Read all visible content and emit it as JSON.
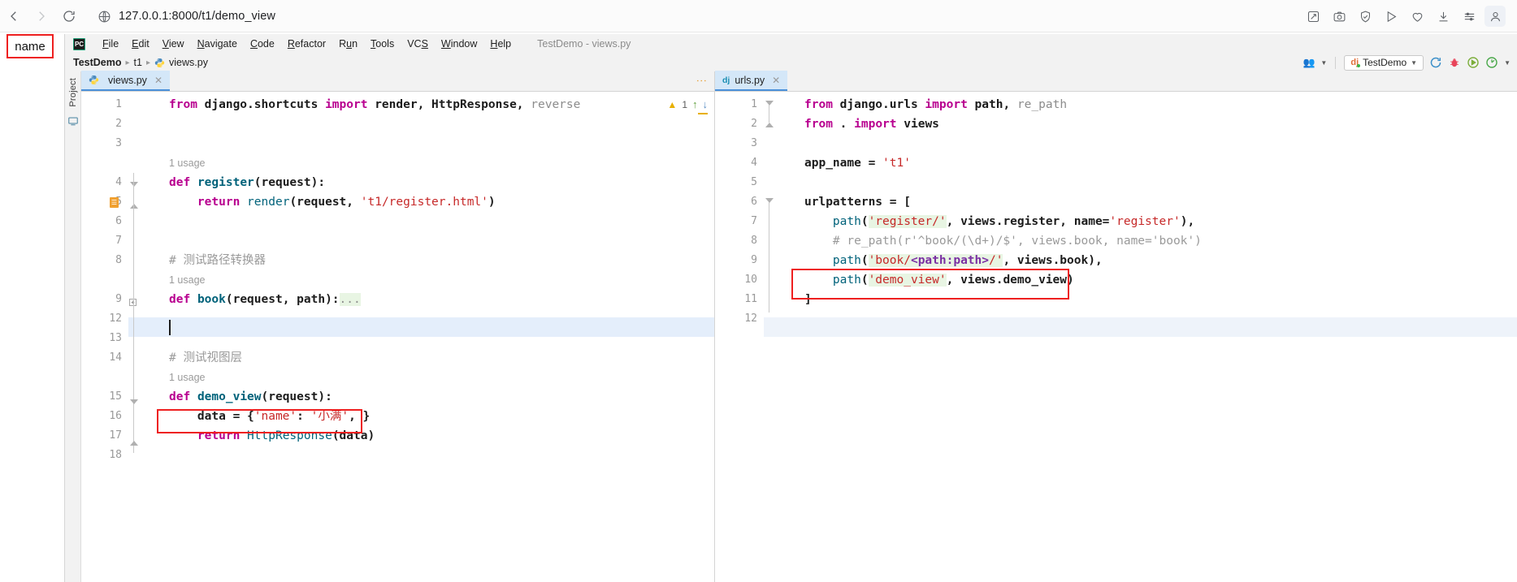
{
  "browser": {
    "back_label": "‹",
    "forward_label": "›",
    "reload_label": "C",
    "url_prefix": "127.0.0.1",
    "url_suffix": ":8000/t1/demo_view",
    "url_full": "127.0.0.1:8000/t1/demo_view",
    "actions": [
      "edit-collect-icon",
      "screenshot-icon",
      "shield-icon",
      "send-icon",
      "heart-icon",
      "download-icon",
      "settings-sliders-icon",
      "profile-icon"
    ]
  },
  "annotations": {
    "name_callout": "name"
  },
  "ide": {
    "logo": "PC",
    "menu": [
      "File",
      "Edit",
      "View",
      "Navigate",
      "Code",
      "Refactor",
      "Run",
      "Tools",
      "VCS",
      "Window",
      "Help"
    ],
    "window_title": "TestDemo - views.py",
    "breadcrumb": [
      "TestDemo",
      "t1",
      "views.py"
    ],
    "toolbar": {
      "run_config": "TestDemo",
      "people_icon": "share-icon",
      "rerun_icon": "rerun-icon",
      "debug_icon": "debug-icon",
      "run_icon": "run-icon",
      "profile_icon": "profiler-icon"
    }
  },
  "tool_strip": {
    "project_label": "Project"
  },
  "left_editor": {
    "tab": "views.py",
    "warning_count": "1",
    "lines": [
      {
        "n": "1",
        "type": "code"
      },
      {
        "n": "2",
        "type": "code"
      },
      {
        "n": "3",
        "type": "code"
      },
      {
        "n": "",
        "type": "usage",
        "text": "1 usage"
      },
      {
        "n": "4",
        "type": "code"
      },
      {
        "n": "5",
        "type": "code"
      },
      {
        "n": "6",
        "type": "code"
      },
      {
        "n": "7",
        "type": "code"
      },
      {
        "n": "8",
        "type": "code"
      },
      {
        "n": "",
        "type": "usage",
        "text": "1 usage"
      },
      {
        "n": "9",
        "type": "code"
      },
      {
        "n": "12",
        "type": "code"
      },
      {
        "n": "13",
        "type": "code"
      },
      {
        "n": "14",
        "type": "code"
      },
      {
        "n": "",
        "type": "usage",
        "text": "1 usage"
      },
      {
        "n": "15",
        "type": "code"
      },
      {
        "n": "16",
        "type": "code"
      },
      {
        "n": "17",
        "type": "code"
      },
      {
        "n": "18",
        "type": "code"
      }
    ],
    "code": {
      "l1": "from django.shortcuts import render, HttpResponse, reverse",
      "usage_a": "1 usage",
      "l4": "def register(request):",
      "l5": "    return render(request, 't1/register.html')",
      "l8": "# 测试路径转换器",
      "usage_b": "1 usage",
      "l9": "def book(request, path):...",
      "l14": "# 测试视图层",
      "usage_c": "1 usage",
      "l15": "def demo_view(request):",
      "l16": "    data = {'name': '小满', }",
      "l17": "    return HttpResponse(data)"
    }
  },
  "right_editor": {
    "tab": "urls.py",
    "lines": [
      "1",
      "2",
      "3",
      "4",
      "5",
      "6",
      "7",
      "8",
      "9",
      "10",
      "11",
      "12"
    ],
    "code": {
      "l1": "from django.urls import path, re_path",
      "l2": "from . import views",
      "l4": "app_name = 't1'",
      "l6": "urlpatterns = [",
      "l7": "    path('register/', views.register, name='register'),",
      "l8": "    # re_path(r'^book/(\\d+)/$', views.book, name='book')",
      "l9": "    path('book/<path:path>/', views.book),",
      "l10": "    path('demo_view', views.demo_view)",
      "l11": "]"
    }
  },
  "colors": {
    "accent_red": "#ee2020",
    "tab_active": "#d4e7f8",
    "current_line": "#e4eefb",
    "keyword": "#b8008f",
    "string": "#c62828",
    "comment": "#9a9a9a",
    "function": "#00627a"
  }
}
